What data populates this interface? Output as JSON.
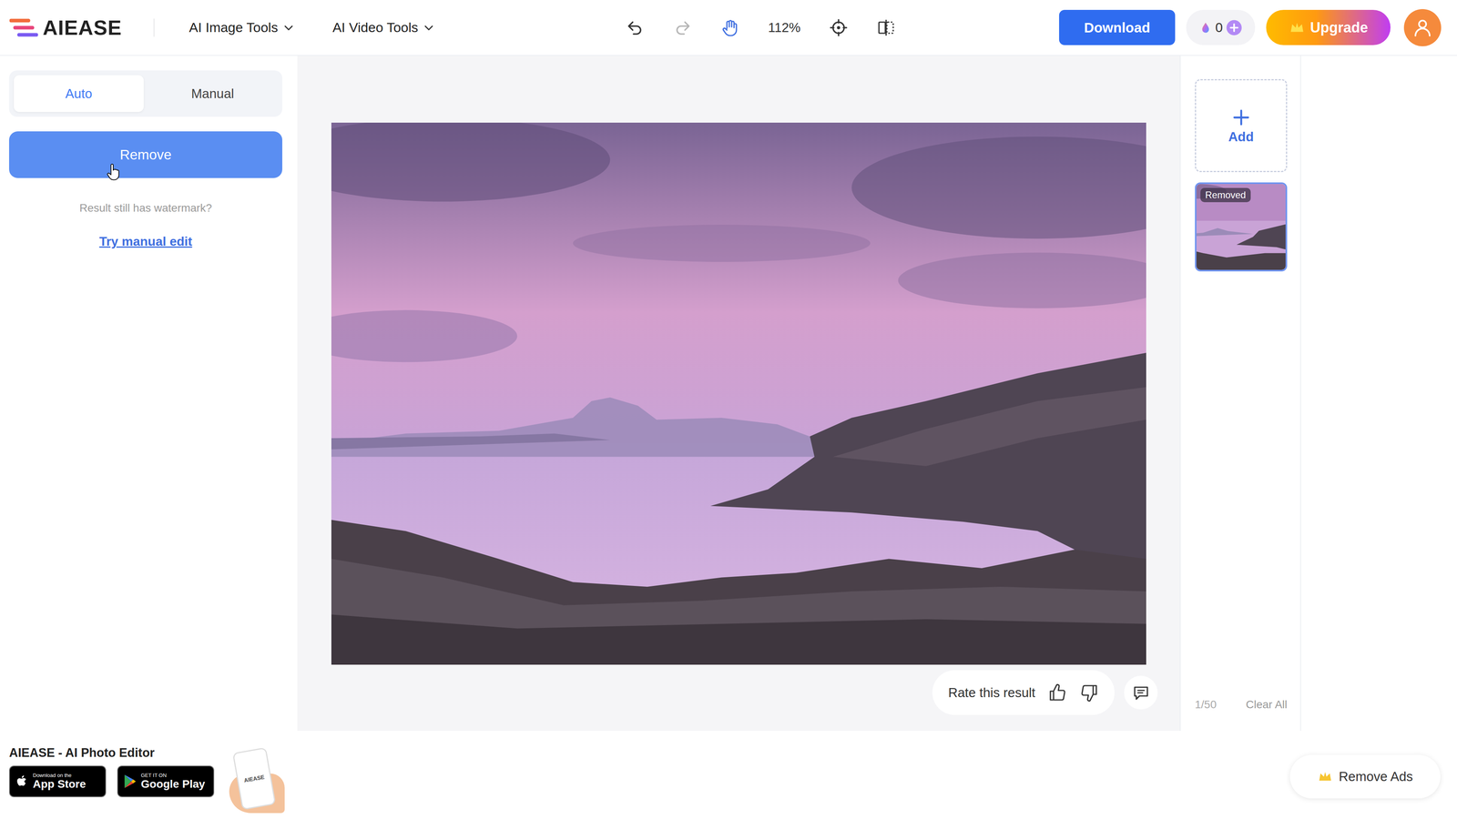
{
  "logo": {
    "text": "AIEASE"
  },
  "nav": [
    {
      "label": "AI Image Tools"
    },
    {
      "label": "AI Video Tools"
    }
  ],
  "tools": {
    "undo_disabled": false,
    "redo_disabled": true,
    "pan_selected": true,
    "zoom": "112%"
  },
  "header_actions": {
    "download": "Download",
    "credits": "0",
    "upgrade": "Upgrade"
  },
  "mode_tabs": [
    {
      "label": "Auto",
      "selected": true
    },
    {
      "label": "Manual",
      "selected": false
    }
  ],
  "remove_button": "Remove",
  "hint": "Result still has watermark?",
  "manual_link": "Try manual edit",
  "rating": {
    "label": "Rate this result"
  },
  "add_tile": {
    "label": "Add"
  },
  "thumbnails": [
    {
      "badge": "Removed",
      "selected": true
    }
  ],
  "page_count": "1/50",
  "clear_all": "Clear All",
  "promo": {
    "title": "AIEASE - AI Photo Editor",
    "app_store_small": "Download on the",
    "app_store": "App Store",
    "google_small": "GET IT ON",
    "google": "Google Play",
    "phone_label": "AIEASE"
  },
  "remove_ads": "Remove Ads"
}
